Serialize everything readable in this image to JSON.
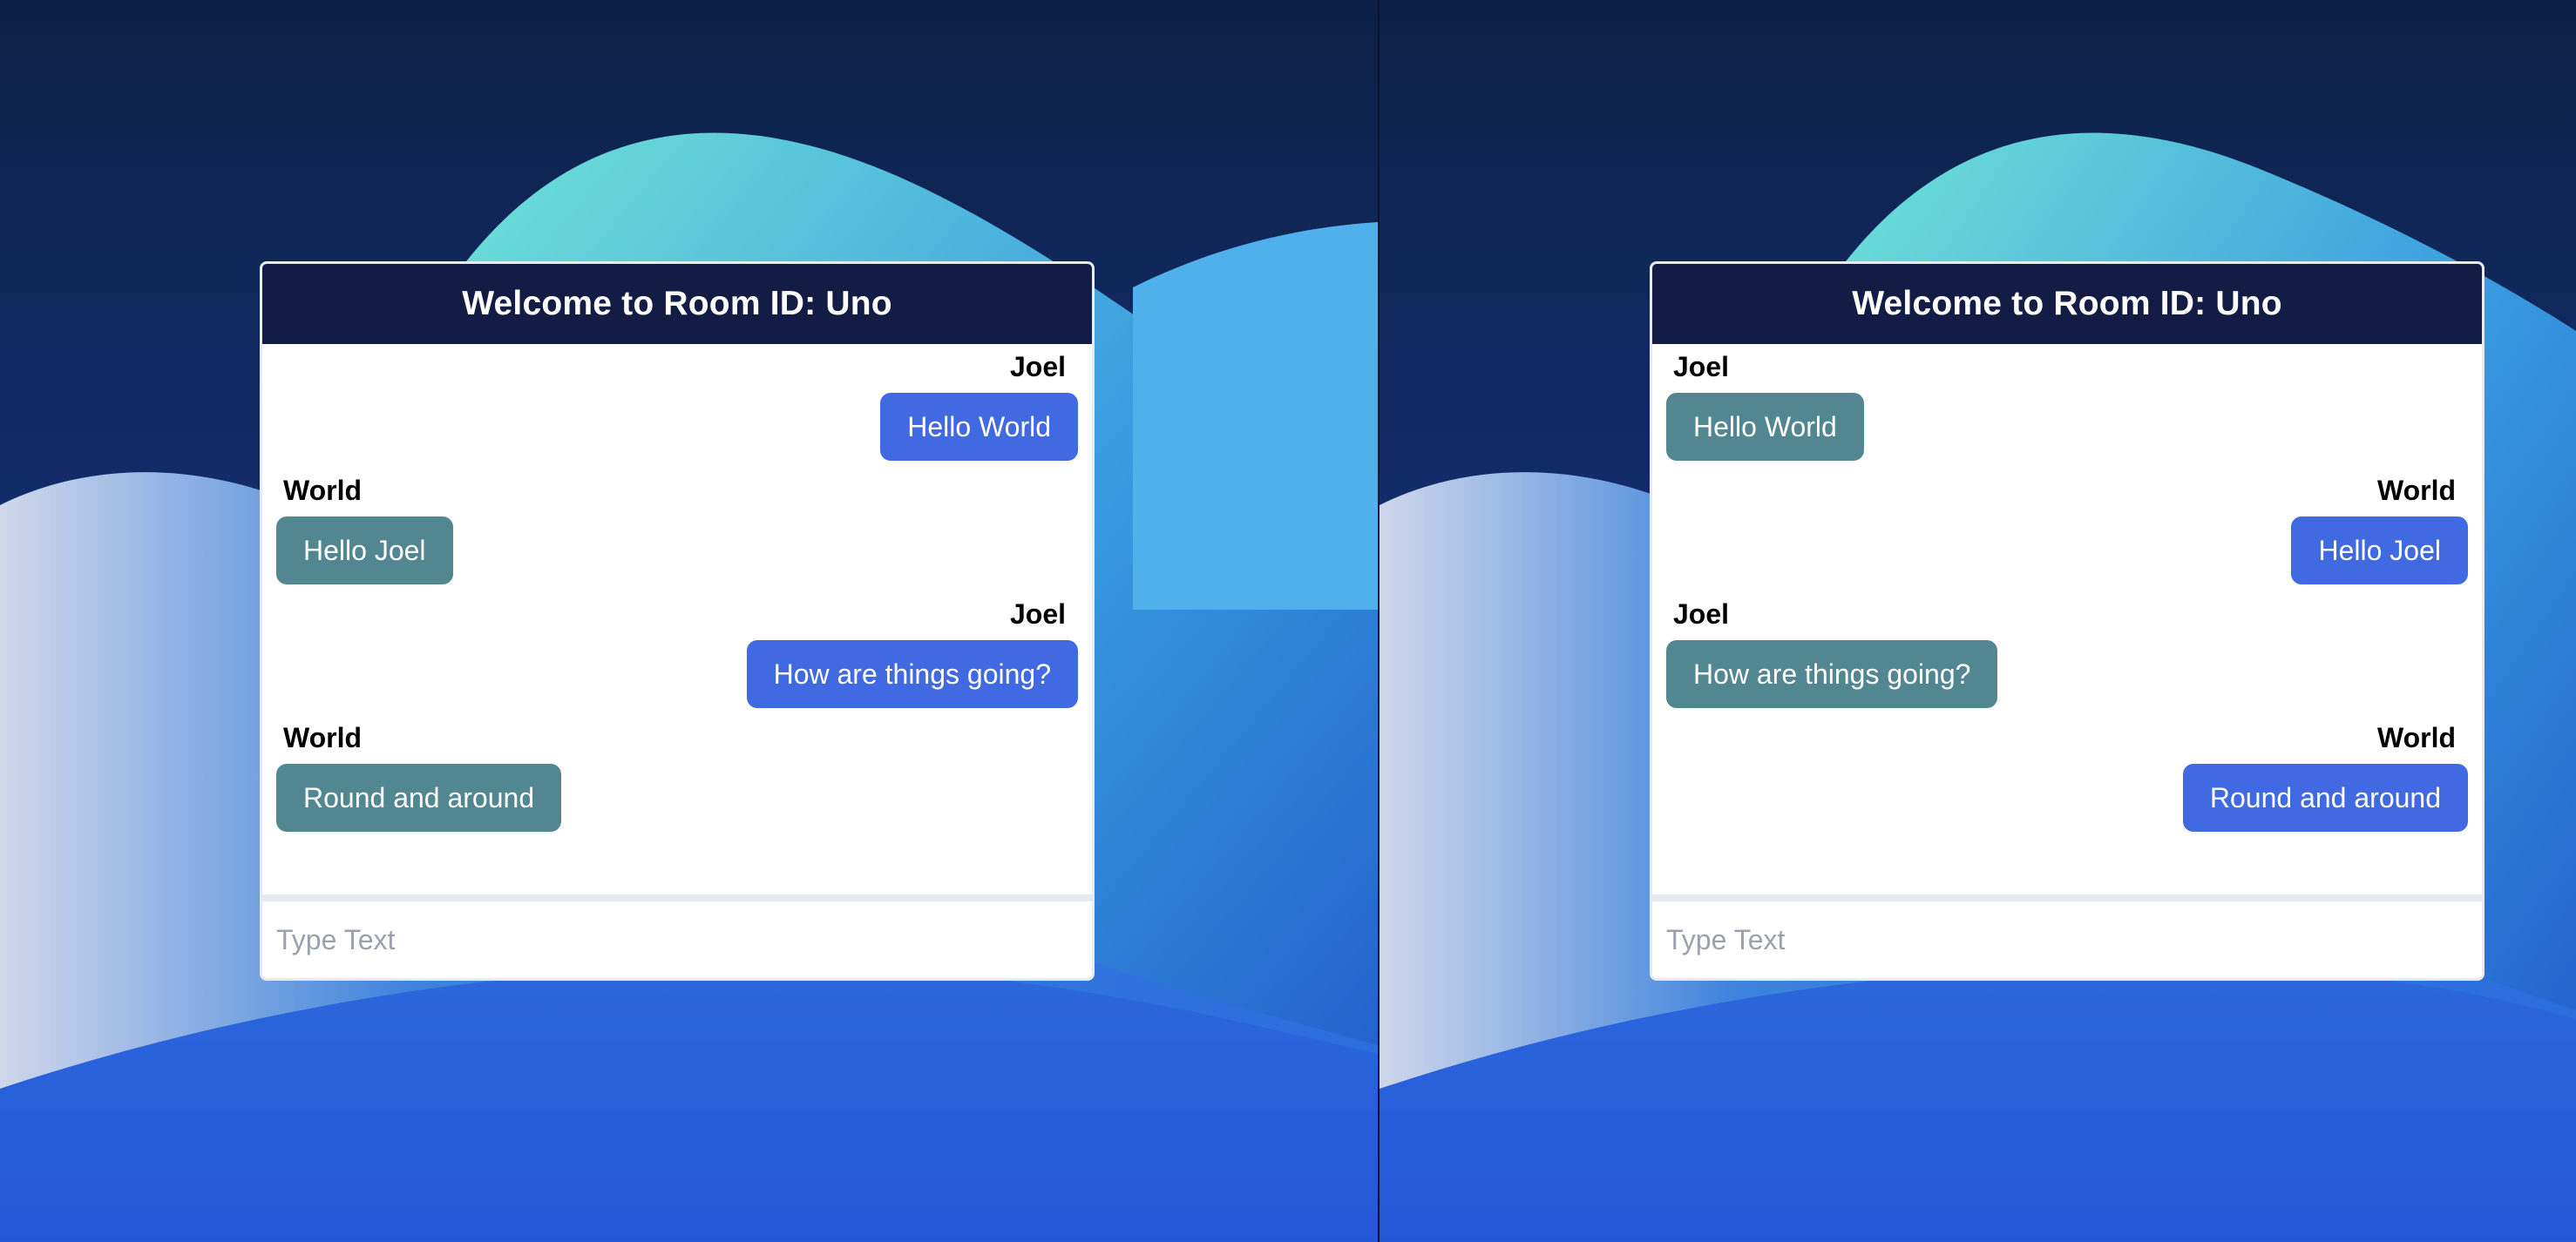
{
  "colors": {
    "header_bg": "#121c44",
    "own_bubble": "#4169e1",
    "other_bubble": "#528792",
    "desktop_bg": "#0c1f48"
  },
  "windows": [
    {
      "title": "Welcome to Room ID: Uno",
      "messages": [
        {
          "sender": "Joel",
          "text": "Hello World",
          "own": true
        },
        {
          "sender": "World",
          "text": "Hello Joel",
          "own": false
        },
        {
          "sender": "Joel",
          "text": "How are things going?",
          "own": true
        },
        {
          "sender": "World",
          "text": "Round and around",
          "own": false
        }
      ],
      "input_placeholder": "Type Text"
    },
    {
      "title": "Welcome to Room ID: Uno",
      "messages": [
        {
          "sender": "Joel",
          "text": "Hello World",
          "own": false
        },
        {
          "sender": "World",
          "text": "Hello Joel",
          "own": true
        },
        {
          "sender": "Joel",
          "text": "How are things going?",
          "own": false
        },
        {
          "sender": "World",
          "text": "Round and around",
          "own": true
        }
      ],
      "input_placeholder": "Type Text"
    }
  ]
}
